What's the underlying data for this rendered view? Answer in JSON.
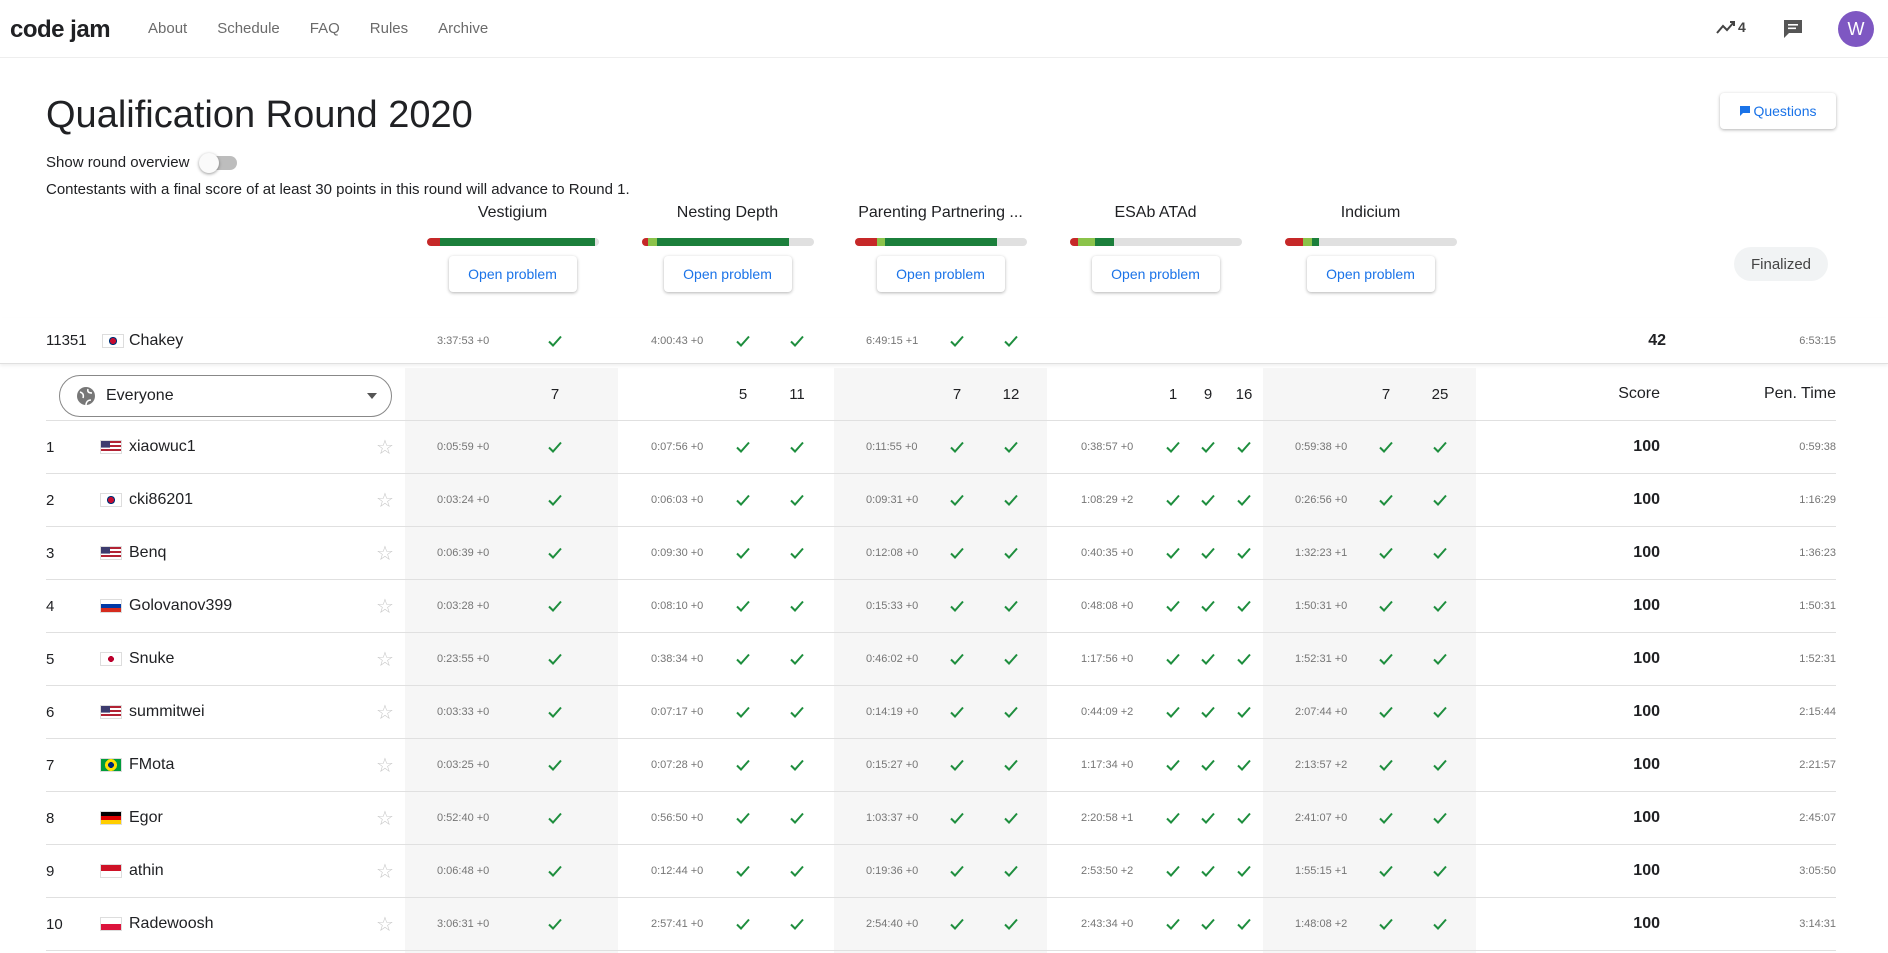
{
  "nav": {
    "logo": "code jam",
    "links": [
      "About",
      "Schedule",
      "FAQ",
      "Rules",
      "Archive"
    ],
    "trend_count": "4",
    "avatar_letter": "W"
  },
  "header": {
    "title": "Qualification Round 2020",
    "questions_label": "Questions",
    "overview_label": "Show round overview",
    "advance_text": "Contestants with a final score of at least 30 points in this round will advance to Round 1.",
    "finalized_label": "Finalized"
  },
  "problems": [
    {
      "title": "Vestigium",
      "button": "Open problem",
      "bar": [
        {
          "color": "#c62828",
          "pct": 8
        },
        {
          "color": "#1b7f3b",
          "pct": 90
        }
      ]
    },
    {
      "title": "Nesting Depth",
      "button": "Open problem",
      "bar": [
        {
          "color": "#c62828",
          "pct": 4
        },
        {
          "color": "#8bc34a",
          "pct": 5
        },
        {
          "color": "#1b7f3b",
          "pct": 77
        }
      ]
    },
    {
      "title": "Parenting Partnering ...",
      "button": "Open problem",
      "bar": [
        {
          "color": "#c62828",
          "pct": 13
        },
        {
          "color": "#8bc34a",
          "pct": 5
        },
        {
          "color": "#1b7f3b",
          "pct": 65
        }
      ]
    },
    {
      "title": "ESAb ATAd",
      "button": "Open problem",
      "bar": [
        {
          "color": "#c62828",
          "pct": 5
        },
        {
          "color": "#8bc34a",
          "pct": 10
        },
        {
          "color": "#1b7f3b",
          "pct": 11
        }
      ]
    },
    {
      "title": "Indicium",
      "button": "Open problem",
      "bar": [
        {
          "color": "#c62828",
          "pct": 11
        },
        {
          "color": "#8bc34a",
          "pct": 5
        },
        {
          "color": "#1b7f3b",
          "pct": 4
        }
      ]
    }
  ],
  "me": {
    "rank": "11351",
    "country": "kr",
    "name": "Chakey",
    "times": [
      "3:37:53 +0",
      "4:00:43 +0",
      "6:49:15 +1"
    ],
    "score": "42",
    "penalty": "6:53:15"
  },
  "filter": {
    "label": "Everyone"
  },
  "header_points": {
    "p1": [
      "7"
    ],
    "p2": [
      "5",
      "11"
    ],
    "p3": [
      "7",
      "12"
    ],
    "p4": [
      "1",
      "9",
      "16"
    ],
    "p5": [
      "7",
      "25"
    ],
    "score_label": "Score",
    "pen_label": "Pen. Time"
  },
  "rows": [
    {
      "rank": "1",
      "country": "us",
      "name": "xiaowuc1",
      "times": [
        "0:05:59 +0",
        "0:07:56 +0",
        "0:11:55 +0",
        "0:38:57 +0",
        "0:59:38 +0"
      ],
      "score": "100",
      "penalty": "0:59:38"
    },
    {
      "rank": "2",
      "country": "kr",
      "name": "cki86201",
      "times": [
        "0:03:24 +0",
        "0:06:03 +0",
        "0:09:31 +0",
        "1:08:29 +2",
        "0:26:56 +0"
      ],
      "score": "100",
      "penalty": "1:16:29"
    },
    {
      "rank": "3",
      "country": "us",
      "name": "Benq",
      "times": [
        "0:06:39 +0",
        "0:09:30 +0",
        "0:12:08 +0",
        "0:40:35 +0",
        "1:32:23 +1"
      ],
      "score": "100",
      "penalty": "1:36:23"
    },
    {
      "rank": "4",
      "country": "ru",
      "name": "Golovanov399",
      "times": [
        "0:03:28 +0",
        "0:08:10 +0",
        "0:15:33 +0",
        "0:48:08 +0",
        "1:50:31 +0"
      ],
      "score": "100",
      "penalty": "1:50:31"
    },
    {
      "rank": "5",
      "country": "jp",
      "name": "Snuke",
      "times": [
        "0:23:55 +0",
        "0:38:34 +0",
        "0:46:02 +0",
        "1:17:56 +0",
        "1:52:31 +0"
      ],
      "score": "100",
      "penalty": "1:52:31"
    },
    {
      "rank": "6",
      "country": "us",
      "name": "summitwei",
      "times": [
        "0:03:33 +0",
        "0:07:17 +0",
        "0:14:19 +0",
        "0:44:09 +2",
        "2:07:44 +0"
      ],
      "score": "100",
      "penalty": "2:15:44"
    },
    {
      "rank": "7",
      "country": "br",
      "name": "FMota",
      "times": [
        "0:03:25 +0",
        "0:07:28 +0",
        "0:15:27 +0",
        "1:17:34 +0",
        "2:13:57 +2"
      ],
      "score": "100",
      "penalty": "2:21:57"
    },
    {
      "rank": "8",
      "country": "de",
      "name": "Egor",
      "times": [
        "0:52:40 +0",
        "0:56:50 +0",
        "1:03:37 +0",
        "2:20:58 +1",
        "2:41:07 +0"
      ],
      "score": "100",
      "penalty": "2:45:07"
    },
    {
      "rank": "9",
      "country": "id",
      "name": "athin",
      "times": [
        "0:06:48 +0",
        "0:12:44 +0",
        "0:19:36 +0",
        "2:53:50 +2",
        "1:55:15 +1"
      ],
      "score": "100",
      "penalty": "3:05:50"
    },
    {
      "rank": "10",
      "country": "pl",
      "name": "Radewoosh",
      "times": [
        "3:06:31 +0",
        "2:57:41 +0",
        "2:54:40 +0",
        "2:43:34 +0",
        "1:48:08 +2"
      ],
      "score": "100",
      "penalty": "3:14:31"
    }
  ]
}
